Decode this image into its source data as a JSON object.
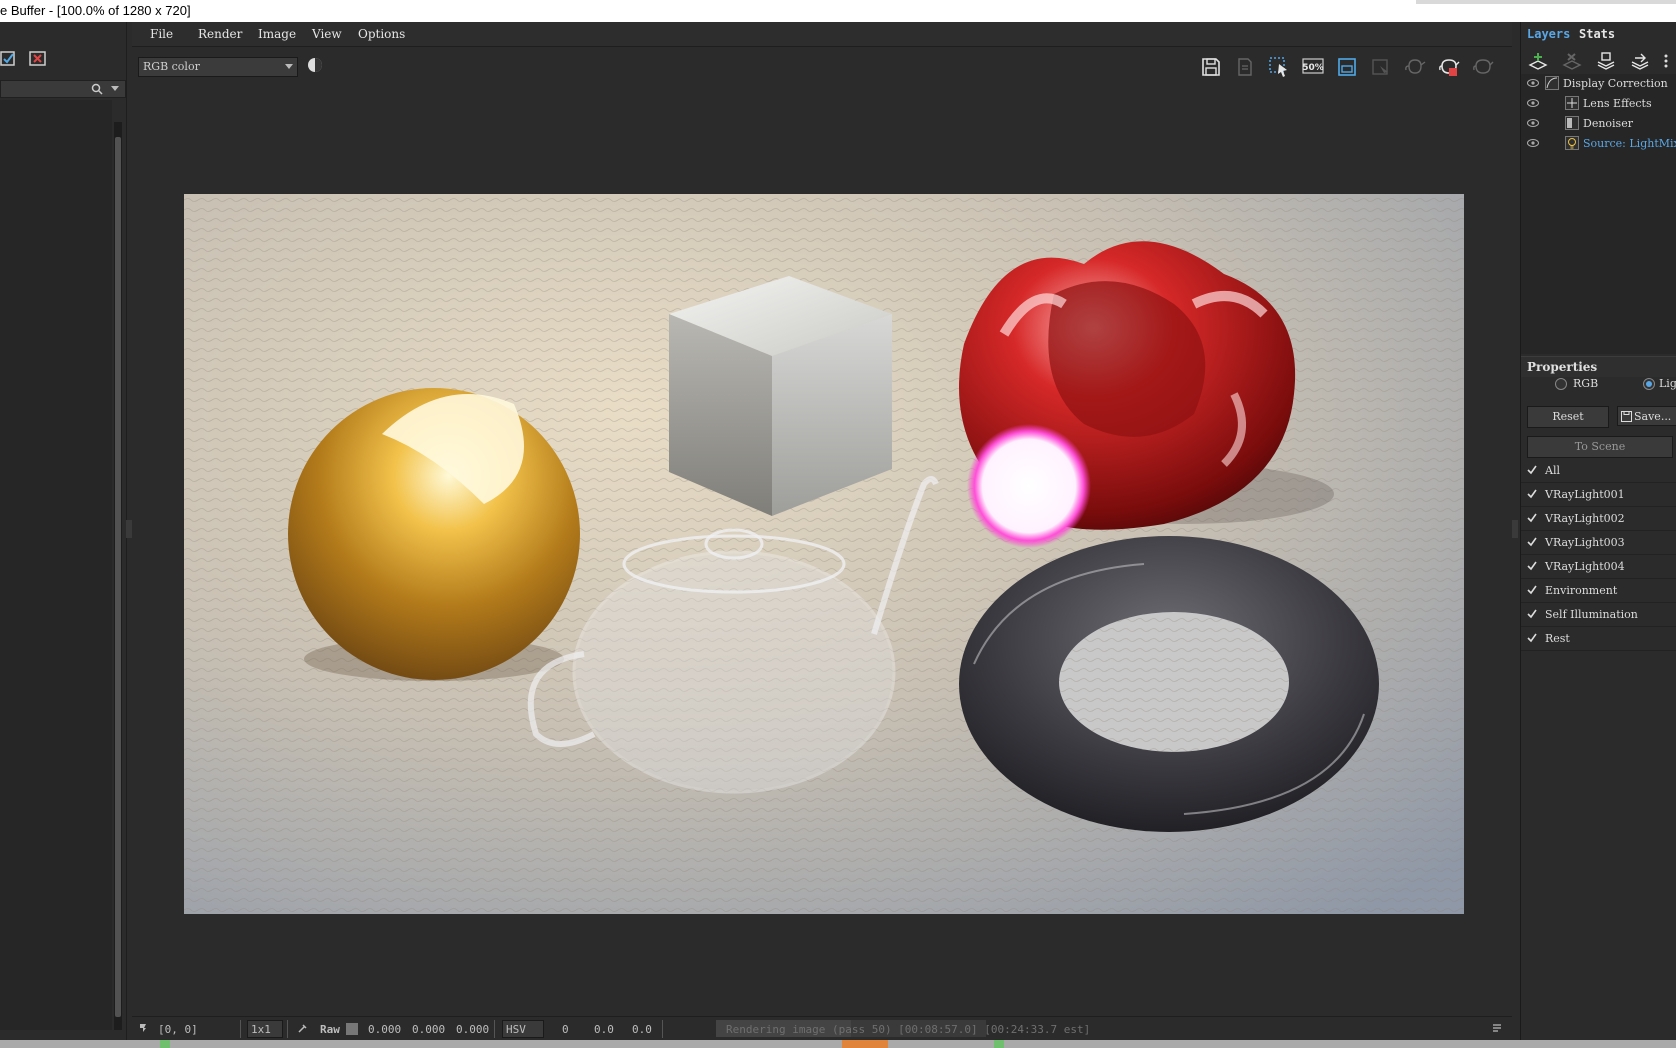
{
  "window": {
    "title": "e Buffer - [100.0% of 1280 x 720]"
  },
  "menu": {
    "items": [
      "File",
      "Render",
      "Image",
      "View",
      "Options"
    ]
  },
  "toolbar": {
    "channel": "RGB color",
    "icons": [
      "save-icon",
      "clone-icon",
      "region-select-icon",
      "zoom-50-icon",
      "fit-view-icon",
      "track-mouse-icon",
      "teapot-icon",
      "teapot-stop-icon",
      "teapot-render-icon"
    ],
    "zoom_label": "50%"
  },
  "statusbar": {
    "coords": "[0, 0]",
    "sample": "1x1",
    "raw_label": "Raw",
    "rgb": [
      "0.000",
      "0.000",
      "0.000"
    ],
    "mode": "HSV",
    "hsv": [
      "0",
      "0.0",
      "0.0"
    ],
    "progress_text": "Rendering image (pass 50) [00:08:57.0] [00:24:33.7 est]",
    "progress_fraction": 0.5
  },
  "right_panel": {
    "tabs": [
      "Layers",
      "Stats"
    ],
    "active_tab": "Layers",
    "accent": "#5aa7e6",
    "layers": [
      {
        "label": "Display Correction",
        "selected": false
      },
      {
        "label": "Lens Effects",
        "selected": false
      },
      {
        "label": "Denoiser",
        "selected": false
      },
      {
        "label": "Source: LightMix",
        "selected": true
      }
    ],
    "properties_title": "Properties",
    "mode_rgb": "RGB",
    "mode_lightmix": "Lig",
    "reset_label": "Reset",
    "save_label": "Save...",
    "to_scene_label": "To Scene",
    "lights": [
      "All",
      "VRayLight001",
      "VRayLight002",
      "VRayLight003",
      "VRayLight004",
      "Environment",
      "Self Illumination",
      "Rest"
    ]
  }
}
